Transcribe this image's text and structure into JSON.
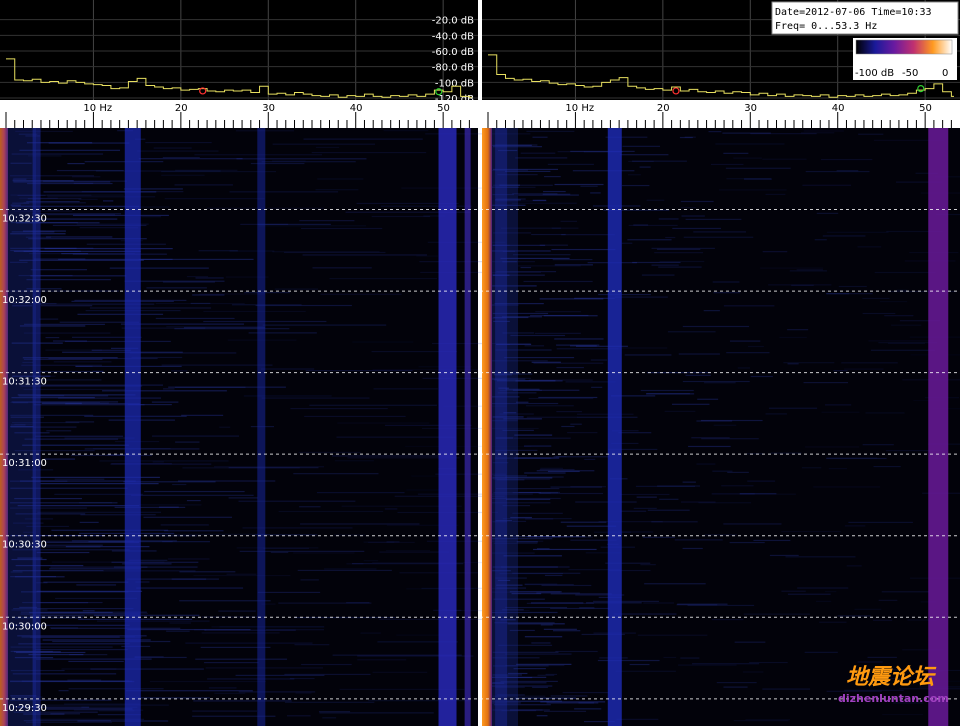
{
  "info_box": {
    "date_line": "Date=2012-07-06 Time=10:33",
    "freq_line": "Freq= 0...53.3 Hz"
  },
  "colorbar": {
    "labels": [
      "-100 dB",
      "-50",
      "0"
    ],
    "stops": [
      "#000000",
      "#1a1a9a",
      "#6a1aa0",
      "#c03070",
      "#ff9a20",
      "#ffffff"
    ]
  },
  "chart_data": {
    "type": "heatmap",
    "title": "",
    "xlabel": "",
    "ylabel": "",
    "freq_range_hz": [
      0,
      53.3
    ],
    "db_range": [
      -120,
      0
    ],
    "panels": [
      {
        "id": "left",
        "spectrum_hz": [
          0,
          1,
          2,
          3,
          4,
          5,
          6,
          7,
          8,
          9,
          10,
          11,
          12,
          13,
          14,
          15,
          16,
          17,
          18,
          19,
          20,
          21,
          22,
          23,
          24,
          25,
          26,
          27,
          28,
          29,
          30,
          31,
          32,
          33,
          34,
          35,
          36,
          37,
          38,
          39,
          40,
          41,
          42,
          43,
          44,
          45,
          46,
          47,
          48,
          49,
          50,
          51,
          52,
          53
        ],
        "spectrum_db": [
          -70,
          -97,
          -98,
          -96,
          -100,
          -99,
          -101,
          -98,
          -100,
          -102,
          -103,
          -104,
          -108,
          -107,
          -99,
          -95,
          -104,
          -106,
          -108,
          -107,
          -110,
          -109,
          -108,
          -111,
          -112,
          -110,
          -111,
          -110,
          -113,
          -105,
          -115,
          -114,
          -116,
          -113,
          -115,
          -117,
          -118,
          -116,
          -119,
          -117,
          -118,
          -115,
          -118,
          -119,
          -117,
          -118,
          -116,
          -118,
          -115,
          -110,
          -112,
          -105,
          -118,
          -119
        ],
        "markers_hz": [
          22.5,
          49.5
        ],
        "marker_colors": [
          "#ff3030",
          "#30d030"
        ]
      },
      {
        "id": "right",
        "spectrum_hz": [
          0,
          1,
          2,
          3,
          4,
          5,
          6,
          7,
          8,
          9,
          10,
          11,
          12,
          13,
          14,
          15,
          16,
          17,
          18,
          19,
          20,
          21,
          22,
          23,
          24,
          25,
          26,
          27,
          28,
          29,
          30,
          31,
          32,
          33,
          34,
          35,
          36,
          37,
          38,
          39,
          40,
          41,
          42,
          43,
          44,
          45,
          46,
          47,
          48,
          49,
          50,
          51,
          52,
          53
        ],
        "spectrum_db": [
          -65,
          -90,
          -95,
          -97,
          -96,
          -99,
          -98,
          -101,
          -103,
          -102,
          -104,
          -106,
          -105,
          -100,
          -97,
          -94,
          -105,
          -107,
          -109,
          -108,
          -110,
          -106,
          -111,
          -109,
          -112,
          -113,
          -111,
          -114,
          -112,
          -113,
          -116,
          -114,
          -117,
          -115,
          -118,
          -116,
          -117,
          -118,
          -116,
          -119,
          -117,
          -118,
          -116,
          -118,
          -117,
          -115,
          -117,
          -116,
          -114,
          -110,
          -108,
          -102,
          -112,
          -118
        ],
        "markers_hz": [
          21.5,
          49.5
        ],
        "marker_colors": [
          "#ff3030",
          "#30d030"
        ]
      }
    ],
    "spectrum_y_labels": [
      "-20.0 dB",
      "-40.0 dB",
      "-60.0 dB",
      "-80.0 dB",
      "-100 dB",
      "-120 dB"
    ],
    "spectrum_y_values": [
      -20,
      -40,
      -60,
      -80,
      -100,
      -120
    ],
    "x_ticks_hz": [
      10,
      20,
      30,
      40,
      50
    ],
    "x_tick_labels": [
      "10 Hz",
      "20",
      "30",
      "40",
      "50"
    ],
    "time_labels": [
      "10:32:30",
      "10:32:00",
      "10:31:30",
      "10:31:00",
      "10:30:30",
      "10:30:00",
      "10:29:30"
    ],
    "waterfall_time_range": [
      "10:29:20",
      "10:33:00"
    ],
    "bright_bands_hz": {
      "left": [
        0.3,
        3.5,
        14.5,
        29.2,
        50.5,
        52.8
      ],
      "right": [
        0.3,
        1.5,
        14.5,
        51.5
      ]
    }
  },
  "watermark": {
    "chinese": "地震论坛",
    "url": "dizhenluntan.com"
  }
}
